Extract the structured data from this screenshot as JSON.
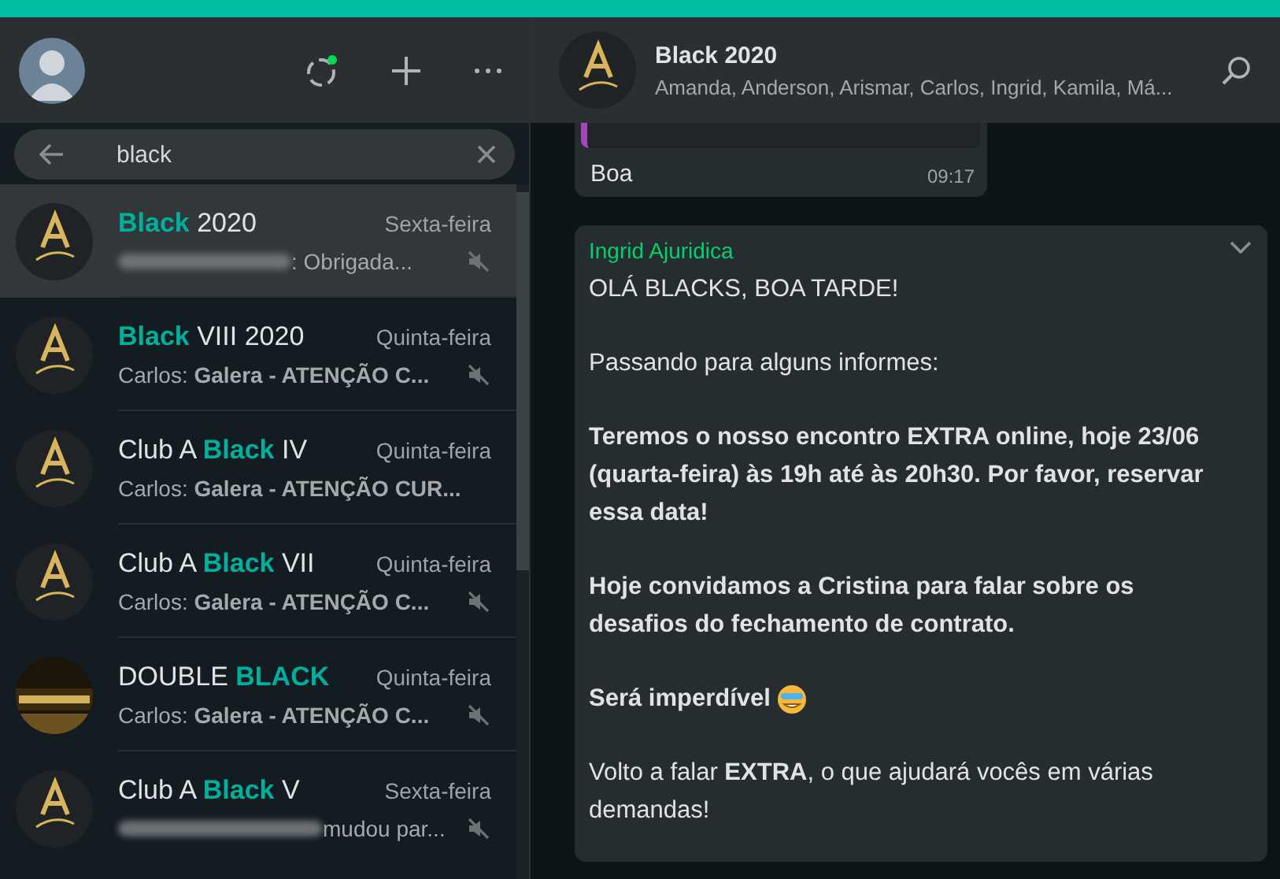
{
  "sidebar": {
    "search": {
      "value": "black"
    },
    "chats": [
      {
        "title": [
          {
            "text": "Black",
            "match": true
          },
          {
            "text": " 2020",
            "match": false
          }
        ],
        "time": "Sexta-feira",
        "preview": ": Obrigada...",
        "sender_hidden": true,
        "muted": true,
        "selected": true,
        "kind": "logo"
      },
      {
        "title": [
          {
            "text": "Black",
            "match": true
          },
          {
            "text": " VIII 2020",
            "match": false
          }
        ],
        "time": "Quinta-feira",
        "preview": "Carlos: **Galera - ATENÇÃO C...**",
        "sender_hidden": false,
        "muted": true,
        "selected": false,
        "kind": "logo"
      },
      {
        "title": [
          {
            "text": "Club A ",
            "match": false
          },
          {
            "text": "Black",
            "match": true
          },
          {
            "text": " IV",
            "match": false
          }
        ],
        "time": "Quinta-feira",
        "preview": "Carlos: **Galera - ATENÇÃO CUR...**",
        "sender_hidden": false,
        "muted": false,
        "selected": false,
        "kind": "logo"
      },
      {
        "title": [
          {
            "text": "Club A ",
            "match": false
          },
          {
            "text": "Black",
            "match": true
          },
          {
            "text": " VII",
            "match": false
          }
        ],
        "time": "Quinta-feira",
        "preview": "Carlos: **Galera - ATENÇÃO C...**",
        "sender_hidden": false,
        "muted": true,
        "selected": false,
        "kind": "logo"
      },
      {
        "title": [
          {
            "text": "DOUBLE ",
            "match": false
          },
          {
            "text": "BLACK",
            "match": true
          }
        ],
        "time": "Quinta-feira",
        "preview": "Carlos: **Galera - ATENÇÃO C...**",
        "sender_hidden": false,
        "muted": true,
        "selected": false,
        "kind": "double"
      },
      {
        "title": [
          {
            "text": "Club A ",
            "match": false
          },
          {
            "text": "Black",
            "match": true
          },
          {
            "text": " V",
            "match": false
          }
        ],
        "time": "Sexta-feira",
        "preview": " mudou par...",
        "sender_hidden": true,
        "muted": true,
        "selected": false,
        "kind": "logo"
      }
    ]
  },
  "chat": {
    "title": "Black 2020",
    "members": "Amanda, Anderson, Arismar, Carlos, Ingrid, Kamila, Má...",
    "messages": [
      {
        "kind": "reply",
        "text": "Boa",
        "time": "09:17"
      },
      {
        "kind": "text",
        "sender": "Ingrid Ajuridica",
        "paragraphs": [
          {
            "text": "OLÁ BLACKS, BOA TARDE!",
            "bold": false,
            "emoji": false
          },
          {
            "text": "Passando para alguns informes:",
            "bold": false,
            "emoji": false
          },
          {
            "text": "Teremos  o nosso encontro EXTRA online, hoje 23/06 (quarta-feira) às 19h até às 20h30. Por favor, reservar essa data!",
            "bold": true,
            "emoji": false
          },
          {
            "text": "Hoje convidamos a Cristina para falar sobre os desafios do fechamento de contrato.",
            "bold": true,
            "emoji": false
          },
          {
            "text": "Será imperdível",
            "bold": true,
            "emoji": true
          },
          {
            "text": "Volto a falar **EXTRA**, o que ajudará vocês em várias demandas!",
            "bold": false,
            "emoji": false
          }
        ]
      }
    ]
  }
}
